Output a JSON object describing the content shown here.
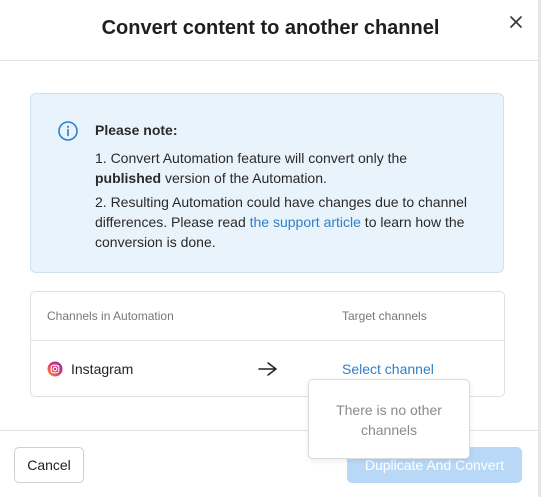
{
  "dialog": {
    "title": "Convert content to another channel",
    "close_icon": "close-icon"
  },
  "note": {
    "icon": "info-icon",
    "title": "Please note:",
    "p1_prefix": "1. Convert Automation feature will convert only the ",
    "p1_bold": "published",
    "p1_suffix": " version of the Automation.",
    "p2_prefix": "2. Resulting Automation could have changes due to channel differences. Please read ",
    "p2_link": "the support article",
    "p2_suffix": " to learn how the conversion is done."
  },
  "table": {
    "col_left": "Channels in Automation",
    "col_right": "Target channels",
    "rows": [
      {
        "channel": "Instagram",
        "channel_icon": "instagram-icon",
        "arrow_icon": "arrow-right-icon",
        "target": "Select channel"
      }
    ]
  },
  "dropdown": {
    "empty_text": "There is no other channels"
  },
  "footer": {
    "cancel_label": "Cancel",
    "primary_label": "Duplicate And Convert",
    "primary_disabled": true
  },
  "colors": {
    "accent": "#2f7fc8",
    "note_bg": "#e9f3fc",
    "disabled_primary": "#b9d8f7"
  }
}
